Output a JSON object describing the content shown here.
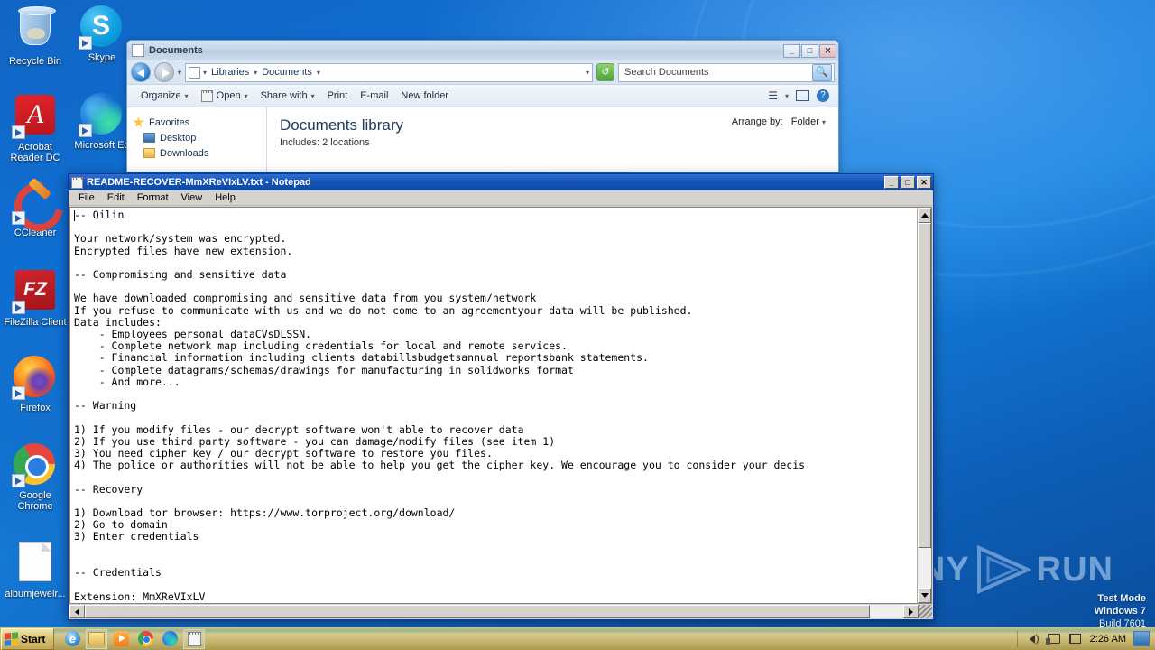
{
  "desktop": {
    "icons": [
      {
        "label": "Recycle Bin",
        "icon": "recycle-bin-icon",
        "shortcut": false
      },
      {
        "label": "Skype",
        "icon": "skype-icon",
        "shortcut": true
      },
      {
        "label": "Acrobat Reader DC",
        "icon": "acrobat-reader-icon",
        "shortcut": true
      },
      {
        "label": "Microsoft Ed",
        "icon": "microsoft-edge-icon",
        "shortcut": true
      },
      {
        "label": "CCleaner",
        "icon": "ccleaner-icon",
        "shortcut": true
      },
      {
        "label": "FileZilla Client",
        "icon": "filezilla-icon",
        "shortcut": true
      },
      {
        "label": "Firefox",
        "icon": "firefox-icon",
        "shortcut": true
      },
      {
        "label": "Google Chrome",
        "icon": "google-chrome-icon",
        "shortcut": true
      },
      {
        "label": "albumjewelr...",
        "icon": "generic-file-icon",
        "shortcut": false
      }
    ],
    "watermark": "ANY RUN",
    "watermark_left": "ANY",
    "watermark_right": "RUN",
    "test_mode": {
      "line1": "Test Mode",
      "line2": "Windows 7",
      "line3": "Build 7601"
    }
  },
  "explorer": {
    "title": "Documents",
    "window_buttons": {
      "minimize": "_",
      "maximize": "□",
      "close": "✕"
    },
    "breadcrumb": [
      "Libraries",
      "Documents"
    ],
    "breadcrumb_caret": "▾",
    "address_dropdown": "▾",
    "refresh_icon": "refresh-icon",
    "search": {
      "placeholder": "Search Documents",
      "value": "",
      "button_icon": "search-icon"
    },
    "toolbar": [
      {
        "label": "Organize",
        "has_caret": true
      },
      {
        "label": "Open",
        "has_caret": true
      },
      {
        "label": "Share with",
        "has_caret": true
      },
      {
        "label": "Print",
        "has_caret": false
      },
      {
        "label": "E-mail",
        "has_caret": false
      },
      {
        "label": "New folder",
        "has_caret": false
      }
    ],
    "view_icons": [
      "view-layout-icon",
      "view-caret-icon",
      "preview-pane-icon",
      "help-icon"
    ],
    "nav_pane": [
      {
        "label": "Favorites",
        "icon": "favorites-star-icon",
        "indent": false
      },
      {
        "label": "Desktop",
        "icon": "desktop-icon",
        "indent": true
      },
      {
        "label": "Downloads",
        "icon": "downloads-folder-icon",
        "indent": true
      }
    ],
    "library_title": "Documents library",
    "library_subtitle": "Includes:  2 locations",
    "arrange_by_label": "Arrange by:",
    "arrange_by_value": "Folder",
    "arrange_by_caret": "▾"
  },
  "notepad": {
    "title": "README-RECOVER-MmXReVIxLV.txt - Notepad",
    "icon": "notepad-icon",
    "window_buttons": {
      "minimize": "_",
      "maximize": "□",
      "close": "✕"
    },
    "menus": [
      "File",
      "Edit",
      "Format",
      "View",
      "Help"
    ],
    "content": "-- Qilin\n\nYour network/system was encrypted.\nEncrypted files have new extension.\n\n-- Compromising and sensitive data\n\nWe have downloaded compromising and sensitive data from you system/network\nIf you refuse to communicate with us and we do not come to an agreementyour data will be published.\nData includes:\n    - Employees personal dataCVsDLSSN.\n    - Complete network map including credentials for local and remote services.\n    - Financial information including clients databillsbudgetsannual reportsbank statements.\n    - Complete datagrams/schemas/drawings for manufacturing in solidworks format\n    - And more...\n\n-- Warning\n\n1) If you modify files - our decrypt software won't able to recover data\n2) If you use third party software - you can damage/modify files (see item 1)\n3) You need cipher key / our decrypt software to restore you files.\n4) The police or authorities will not be able to help you get the cipher key. We encourage you to consider your decis\n\n-- Recovery\n\n1) Download tor browser: https://www.torproject.org/download/\n2) Go to domain\n3) Enter credentials\n\n\n-- Credentials\n\nExtension: MmXReVIxLV"
  },
  "taskbar": {
    "start_label": "Start",
    "quick_launch": [
      {
        "name": "internet-explorer-icon",
        "active": false
      },
      {
        "name": "windows-explorer-icon",
        "active": true
      },
      {
        "name": "windows-media-player-icon",
        "active": false
      },
      {
        "name": "google-chrome-icon",
        "active": false
      },
      {
        "name": "microsoft-edge-icon",
        "active": false
      },
      {
        "name": "notepad-icon",
        "active": true
      }
    ],
    "tray": {
      "volume_icon": "volume-icon",
      "network_icon": "network-icon",
      "flag_icon": "action-center-flag-icon",
      "clock": "2:26 AM",
      "show_desktop": "show-desktop-button"
    }
  },
  "colors": {
    "desktop_blue": "#0f6fd2",
    "titlebar_blue": "#1352b4",
    "taskbar_olive": "#c8b76f",
    "window_face": "#d6d3ce"
  }
}
